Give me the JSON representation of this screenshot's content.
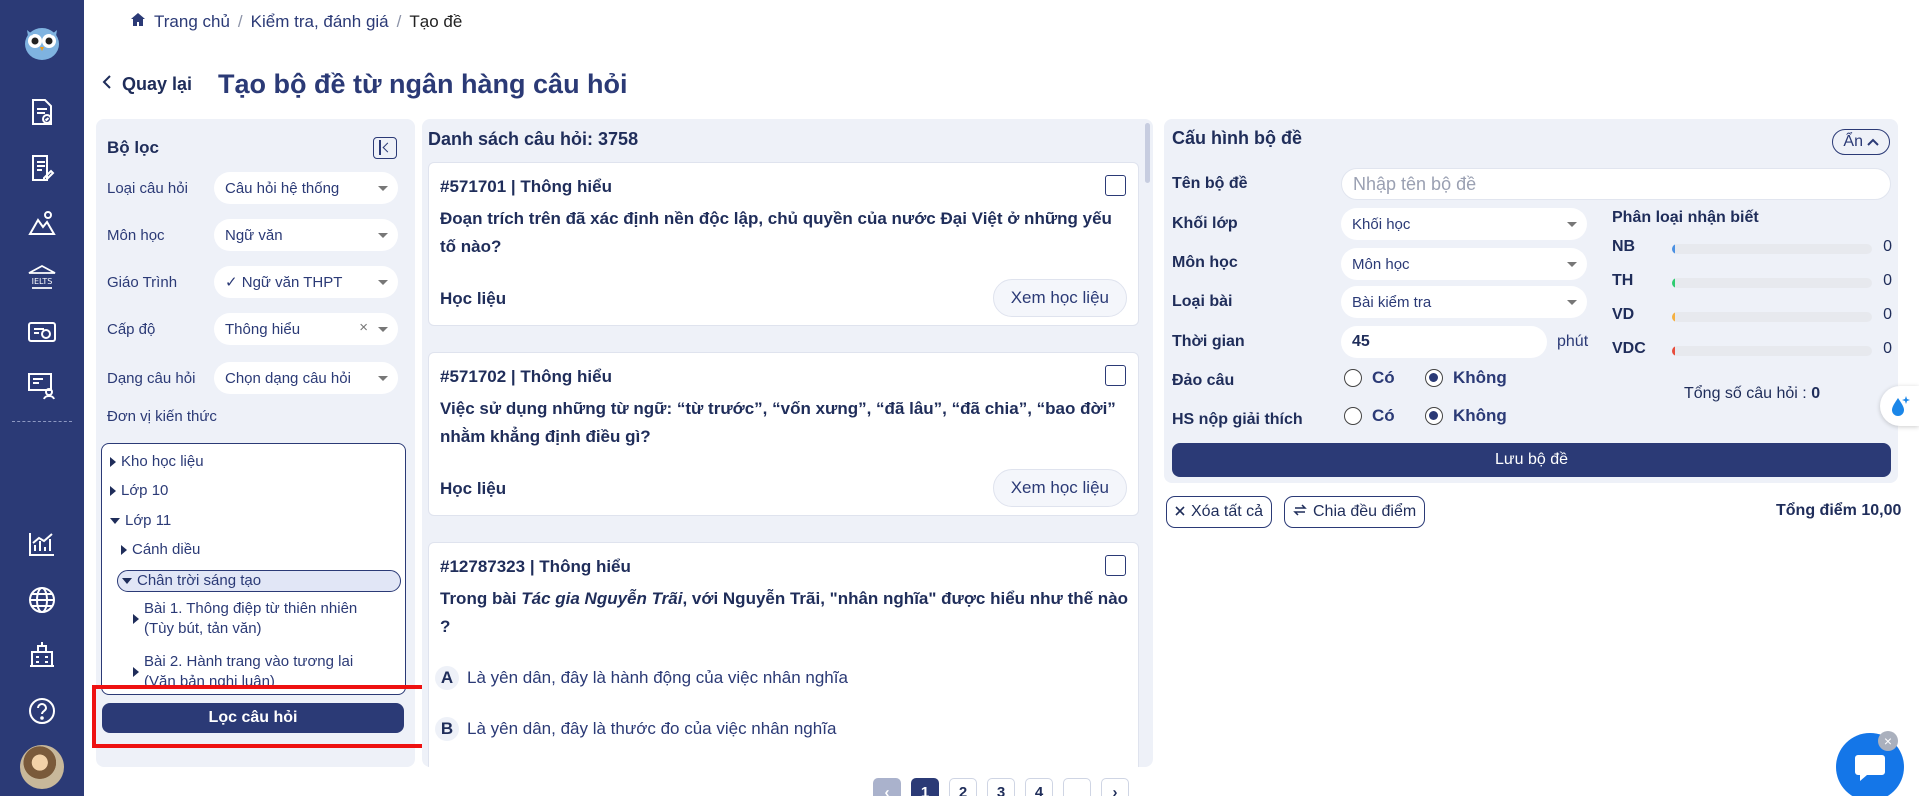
{
  "breadcrumb": {
    "home": "Trang chủ",
    "section": "Kiểm tra, đánh giá",
    "current": "Tạo đề"
  },
  "header": {
    "back_label": "Quay lại",
    "title": "Tạo bộ đề từ ngân hàng câu hỏi"
  },
  "filter": {
    "title": "Bộ lọc",
    "fields": [
      {
        "label": "Loại câu hỏi",
        "value": "Câu hỏi hệ thống"
      },
      {
        "label": "Môn học",
        "value": "Ngữ văn"
      },
      {
        "label": "Giáo Trình",
        "value": "✓ Ngữ văn THPT"
      },
      {
        "label": "Cấp độ",
        "value": "Thông hiểu"
      },
      {
        "label": "Dạng câu hỏi",
        "value": "Chọn dạng câu hỏi"
      }
    ],
    "knowledge_label": "Đơn vị kiến thức",
    "tree": [
      "Kho học liệu",
      "Lớp 10",
      "Lớp 11",
      "Cánh diều",
      "Chân trời sáng tạo",
      "Bài 1. Thông điệp từ thiên nhiên",
      "(Tùy bút, tản văn)",
      "Bài 2. Hành trang vào tương lai",
      "(Văn bản nghị luận)"
    ],
    "filter_button": "Lọc câu hỏi"
  },
  "questions": {
    "title": "Danh sách câu hỏi: 3758",
    "items": [
      {
        "header": "#571701   |   Thông hiểu",
        "text": "Đoạn trích trên đã xác định nền độc lập, chủ quyền của nước Đại Việt ở những yếu tố nào?",
        "resource_label": "Học liệu",
        "view_button": "Xem học liệu"
      },
      {
        "header": "#571702   |   Thông hiểu",
        "text": "Việc sử dụng những từ ngữ: “từ trước”, “vốn xưng”, “đã lâu”, “đã chia”, “bao đời” nhằm khẳng định điều gì?",
        "resource_label": "Học liệu",
        "view_button": "Xem học liệu"
      },
      {
        "header": "#12787323   |   Thông hiểu",
        "text_before": "Trong bài ",
        "text_italic": "Tác gia Nguyễn Trãi",
        "text_after": ", với Nguyễn Trãi, \"nhân nghĩa\" được hiểu như thế nào ?",
        "options": [
          {
            "letter": "A",
            "text": "Là yên dân, đây là hành động của việc nhân nghĩa"
          },
          {
            "letter": "B",
            "text": "Là yên dân, đây là thước đo của việc nhân nghĩa"
          }
        ]
      }
    ]
  },
  "pagination": {
    "prev": "‹",
    "pages": [
      "1",
      "2",
      "3",
      "4"
    ],
    "active": "1",
    "next": "›"
  },
  "config": {
    "title": "Cấu hình bộ đề",
    "hide_button": "Ẩn",
    "name_label": "Tên bộ đề",
    "name_placeholder": "Nhập tên bộ đề",
    "grade_label": "Khối lớp",
    "grade_value": "Khối học",
    "subject_label": "Môn học",
    "subject_value": "Môn học",
    "type_label": "Loại bài",
    "type_value": "Bài kiểm tra",
    "time_label": "Thời gian",
    "time_value": "45",
    "time_unit": "phút",
    "shuffle_label": "Đảo câu",
    "explain_label": "HS nộp giải thích",
    "yes": "Có",
    "no": "Không",
    "classification_title": "Phân loại nhận biết",
    "classification": [
      {
        "name": "NB",
        "value": "0",
        "color": "#4a90e2"
      },
      {
        "name": "TH",
        "value": "0",
        "color": "#2ecc71"
      },
      {
        "name": "VD",
        "value": "0",
        "color": "#f5b041"
      },
      {
        "name": "VDC",
        "value": "0",
        "color": "#e74c3c"
      }
    ],
    "total_questions_label": "Tổng số câu hỏi :",
    "total_questions_value": "0",
    "save_button": "Lưu bộ đề"
  },
  "actions": {
    "clear_all": "Xóa tất cả",
    "split_points": "Chia đều điểm",
    "total_points": "Tổng điểm 10,00"
  },
  "colors": {
    "primary": "#2b3a76",
    "panel": "#eef1f8",
    "highlight": "#ee1111"
  }
}
